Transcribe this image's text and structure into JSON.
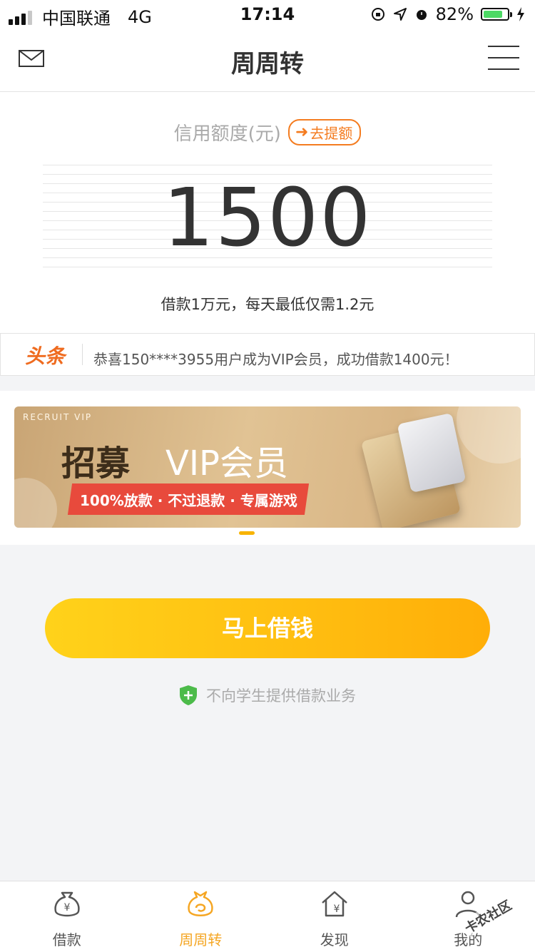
{
  "status_bar": {
    "carrier": "中国联通",
    "network": "4G",
    "time": "17:14",
    "battery": "82%",
    "battery_level": 0.82
  },
  "nav": {
    "title": "周周转",
    "left_icon": "mail-icon",
    "right_icon": "menu-icon"
  },
  "credit": {
    "label": "信用额度(元)",
    "raise_label": "去提额",
    "amount": "1500",
    "note": "借款1万元，每天最低仅需1.2元"
  },
  "ticker": {
    "logo": "头条",
    "text": "恭喜150****3955用户成为VIP会员，成功借款1400元！"
  },
  "banner": {
    "tag": "RECRUIT VIP",
    "title": "招募",
    "title_vip": "VIP会员",
    "ribbon": "100%放款 · 不过退款 · 专属游戏"
  },
  "main": {
    "borrow_button": "马上借钱",
    "notice": "不向学生提供借款业务"
  },
  "tabs": [
    {
      "label": "借款",
      "icon": "moneybag-icon",
      "active": false
    },
    {
      "label": "周周转",
      "icon": "bag-icon",
      "active": true
    },
    {
      "label": "发现",
      "icon": "house-yen-icon",
      "active": false
    },
    {
      "label": "我的",
      "icon": "user-icon",
      "active": false
    }
  ],
  "watermark": "卡农社区",
  "colors": {
    "accent": "#f5a623",
    "orange": "#f47c20",
    "button_start": "#ffd21a",
    "button_end": "#ffae08"
  }
}
